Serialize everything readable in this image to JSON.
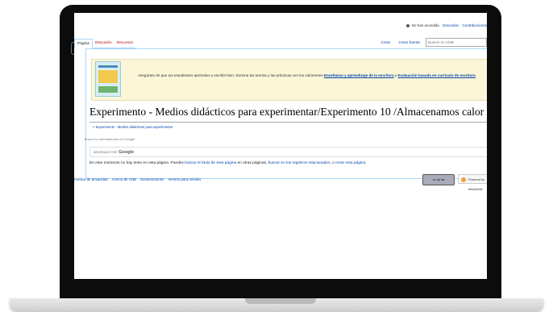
{
  "personal_bar": {
    "not_logged": "No has accedido",
    "discussion": "Discusión",
    "contributions": "Contribuciones"
  },
  "tabs_left": [
    "Página",
    "Discusión",
    "Recursos"
  ],
  "tabs_right": [
    "Crear",
    "Crear fuente"
  ],
  "search": {
    "placeholder": "Buscar en CNB"
  },
  "banner": {
    "text_start": "Asegúrate de que tus estudiantes aprendan a escribir bien. Domina las teorías y las prácticas con los volúmenes",
    "link1": "Enseñanza y aprendizaje de la escritura",
    "join": "y",
    "link2": "Evaluación basada en currículo de escritura",
    "end": "."
  },
  "page": {
    "title": "Experimento - Medios didácticos para experimentar/Experimento 10 /Almacenamos calor",
    "subpage_link": "< Experimento - Medios didácticos para experimentar",
    "search_label": "Busca en cnbGuatemala con Google",
    "powered_by": "MEJORADO POR",
    "google": "Google",
    "notext_start": "En este momento no hay texto en esta página. Puedes",
    "notext_link1": "buscar el título de esta página",
    "notext_mid1": "en otras páginas,",
    "notext_link2": "buscar en los registros relacionados",
    "notext_mid2": ", o",
    "notext_link3": "crear esta página",
    "notext_end": "."
  },
  "footer": {
    "links": [
      "Política de privacidad",
      "Acerca de CNB",
      "Exoneraciones",
      "Versión para móviles"
    ],
    "cc_badge": "cc by sa",
    "mw_badge": "Powered by MediaWiki"
  }
}
